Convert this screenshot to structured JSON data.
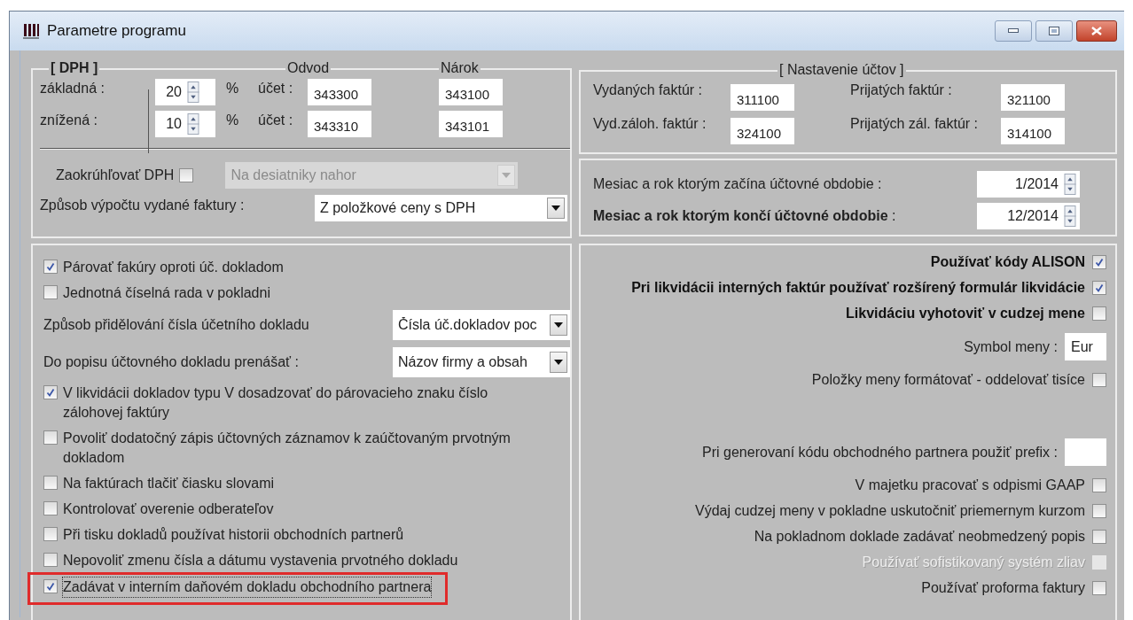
{
  "window": {
    "title": "Parametre programu"
  },
  "dph": {
    "title": "[ DPH ]",
    "col_odvod": "Odvod",
    "col_narok": "Nárok",
    "rates": [
      {
        "label": "základná :",
        "value": "20",
        "unit": "%",
        "account_label": "účet :",
        "odvod": "343300",
        "narok": "343100"
      },
      {
        "label": "znížená :",
        "value": "10",
        "unit": "%",
        "account_label": "účet :",
        "odvod": "343310",
        "narok": "343101"
      }
    ],
    "rounding": {
      "label": "Zaokrúhľovať DPH",
      "checked": false,
      "value": "Na desiatniky nahor",
      "disabled": true
    },
    "method": {
      "label": "Způsob výpočtu vydané faktury :",
      "value": "Z položkové ceny s DPH",
      "disabled": false
    }
  },
  "accounts": {
    "title": "[ Nastavenie účtov ]",
    "fields": [
      {
        "label": "Vydaných faktúr :",
        "value": "311100"
      },
      {
        "label": "Prijatých faktúr :",
        "value": "321100"
      },
      {
        "label": "Vyd.záloh. faktúr :",
        "value": "324100"
      },
      {
        "label": "Prijatých zál. faktúr :",
        "value": "314100"
      }
    ]
  },
  "period": [
    {
      "label": "Mesiac a rok ktorým začína účtovné obdobie :",
      "value": "1/2014"
    },
    {
      "label": "**Mesiac a rok ktorým končí účtovné obdobie** :",
      "value": "12/2014"
    }
  ],
  "left_options": [
    {
      "kind": "checkbox",
      "label": "Párovať fakúry oproti úč. dokladom",
      "checked": true,
      "highlighted": false
    },
    {
      "kind": "checkbox",
      "label": "Jednotná číselná rada v pokladni",
      "checked": false,
      "highlighted": false
    },
    {
      "kind": "select",
      "label": "Způsob přidělování čísla účetního dokladu",
      "value": "Čísla úč.dokladov poc"
    },
    {
      "kind": "select",
      "label": "Do popisu účtovného dokladu prenášať :",
      "value": "Názov firmy a obsah"
    },
    {
      "kind": "checkbox",
      "label": "V likvidácii dokladov typu V dosadzovať do párovacieho znaku číslo zálohovej faktúry",
      "checked": true,
      "highlighted": false
    },
    {
      "kind": "checkbox",
      "label": "Povoliť dodatočný zápis účtovných záznamov k zaúčtovaným prvotným dokladom",
      "checked": false,
      "highlighted": false
    },
    {
      "kind": "checkbox",
      "label": "Na faktúrach tlačiť čiasku slovami",
      "checked": false,
      "highlighted": false
    },
    {
      "kind": "checkbox",
      "label": "Kontrolovať overenie odberateľov",
      "checked": false,
      "highlighted": false
    },
    {
      "kind": "checkbox",
      "label": "Při tisku dokladů používat historii obchodních partnerů",
      "checked": false,
      "highlighted": false
    },
    {
      "kind": "checkbox",
      "label": "Nepovoliť zmenu čísla a dátumu vystavenia prvotného dokladu",
      "checked": false,
      "highlighted": false
    },
    {
      "kind": "checkbox",
      "label": "Zadávat v interním daňovém dokladu obchodního partnera",
      "checked": true,
      "highlighted": true
    }
  ],
  "right_options": [
    {
      "kind": "checkbox",
      "label": "Používať kódy ALISON",
      "checked": true,
      "bold": true,
      "disabled": false
    },
    {
      "kind": "checkbox",
      "label": "Pri likvidácii interných faktúr používať rozšírený formulár likvidácie",
      "checked": true,
      "bold": true,
      "disabled": false
    },
    {
      "kind": "checkbox",
      "label": "Likvidáciu vyhotoviť v cudzej mene",
      "checked": false,
      "bold": true,
      "disabled": false
    },
    {
      "kind": "input",
      "label": "Symbol meny :",
      "value": "Eur"
    },
    {
      "kind": "checkbox",
      "label": "Položky meny formátovať - oddelovať tisíce",
      "checked": false,
      "bold": false,
      "disabled": false
    },
    {
      "kind": "input",
      "label": "Pri generovaní kódu obchodného partnera použiť prefix :"
    },
    {
      "kind": "checkbox",
      "label": "V majetku pracovať s odpismi GAAP",
      "checked": false,
      "bold": false,
      "disabled": false
    },
    {
      "kind": "checkbox",
      "label": "Výdaj cudzej meny v pokladne uskutočniť priemernym kurzom",
      "checked": false,
      "bold": false,
      "disabled": false
    },
    {
      "kind": "checkbox",
      "label": "Na pokladnom doklade zadávať neobmedzený popis",
      "checked": false,
      "bold": false,
      "disabled": false
    },
    {
      "kind": "checkbox",
      "label": "Používať sofistikovaný systém zliav",
      "checked": false,
      "bold": false,
      "disabled": true
    },
    {
      "kind": "checkbox",
      "label": "Používať proforma faktury",
      "checked": false,
      "bold": false,
      "disabled": false
    }
  ]
}
